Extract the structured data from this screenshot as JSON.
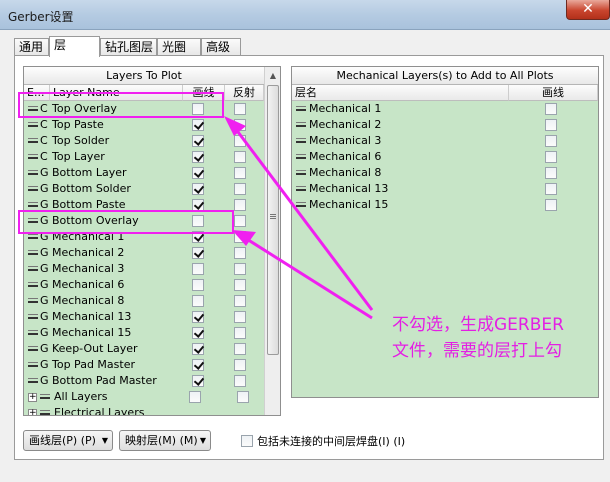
{
  "window": {
    "title": "Gerber设置",
    "close": "✕"
  },
  "tabs": [
    "通用",
    "层",
    "钻孔图层",
    "光圈",
    "高级"
  ],
  "left_panel": {
    "title": "Layers To Plot",
    "col_ext": "E...",
    "col_name": "Layer Name",
    "col_plot": "画线",
    "col_mirror": "反射",
    "rows": [
      {
        "c": "C",
        "name": "Top Overlay",
        "plot": false,
        "mirror": false
      },
      {
        "c": "C",
        "name": "Top Paste",
        "plot": true,
        "mirror": false
      },
      {
        "c": "C",
        "name": "Top Solder",
        "plot": true,
        "mirror": false
      },
      {
        "c": "C",
        "name": "Top Layer",
        "plot": true,
        "mirror": false
      },
      {
        "c": "G",
        "name": "Bottom Layer",
        "plot": true,
        "mirror": false
      },
      {
        "c": "G",
        "name": "Bottom Solder",
        "plot": true,
        "mirror": false
      },
      {
        "c": "G",
        "name": "Bottom Paste",
        "plot": true,
        "mirror": false
      },
      {
        "c": "G",
        "name": "Bottom Overlay",
        "plot": false,
        "mirror": false
      },
      {
        "c": "G",
        "name": "Mechanical 1",
        "plot": true,
        "mirror": false
      },
      {
        "c": "G",
        "name": "Mechanical 2",
        "plot": true,
        "mirror": false
      },
      {
        "c": "G",
        "name": "Mechanical 3",
        "plot": false,
        "mirror": false
      },
      {
        "c": "G",
        "name": "Mechanical 6",
        "plot": false,
        "mirror": false
      },
      {
        "c": "G",
        "name": "Mechanical 8",
        "plot": false,
        "mirror": false
      },
      {
        "c": "G",
        "name": "Mechanical 13",
        "plot": true,
        "mirror": false
      },
      {
        "c": "G",
        "name": "Mechanical 15",
        "plot": true,
        "mirror": false
      },
      {
        "c": "G",
        "name": "Keep-Out Layer",
        "plot": true,
        "mirror": false
      },
      {
        "c": "G",
        "name": "Top Pad Master",
        "plot": true,
        "mirror": false
      },
      {
        "c": "G",
        "name": "Bottom Pad Master",
        "plot": true,
        "mirror": false
      }
    ],
    "groups": [
      {
        "name": "All Layers"
      },
      {
        "name": "Electrical Layers"
      }
    ]
  },
  "right_panel": {
    "title": "Mechanical Layers(s) to Add to All Plots",
    "col_name": "层名",
    "col_plot": "画线",
    "rows": [
      {
        "name": "Mechanical 1",
        "plot": false
      },
      {
        "name": "Mechanical 2",
        "plot": false
      },
      {
        "name": "Mechanical 3",
        "plot": false
      },
      {
        "name": "Mechanical 6",
        "plot": false
      },
      {
        "name": "Mechanical 8",
        "plot": false
      },
      {
        "name": "Mechanical 13",
        "plot": false
      },
      {
        "name": "Mechanical 15",
        "plot": false
      }
    ]
  },
  "bottom": {
    "plot_layers_label": "画线层(P) (P)",
    "mirror_layers_label": "映射层(M) (M)",
    "include_unconnected_label": "包括未连接的中间层焊盘(I) (I)",
    "include_unconnected": false
  },
  "annotation": {
    "line1": "不勾选，生成GERBER",
    "line2": "文件，需要的层打上勾",
    "color": "#e41fe4"
  },
  "colors": {
    "panel_bg": "#c7e5c7",
    "highlight": "#f020f0"
  }
}
